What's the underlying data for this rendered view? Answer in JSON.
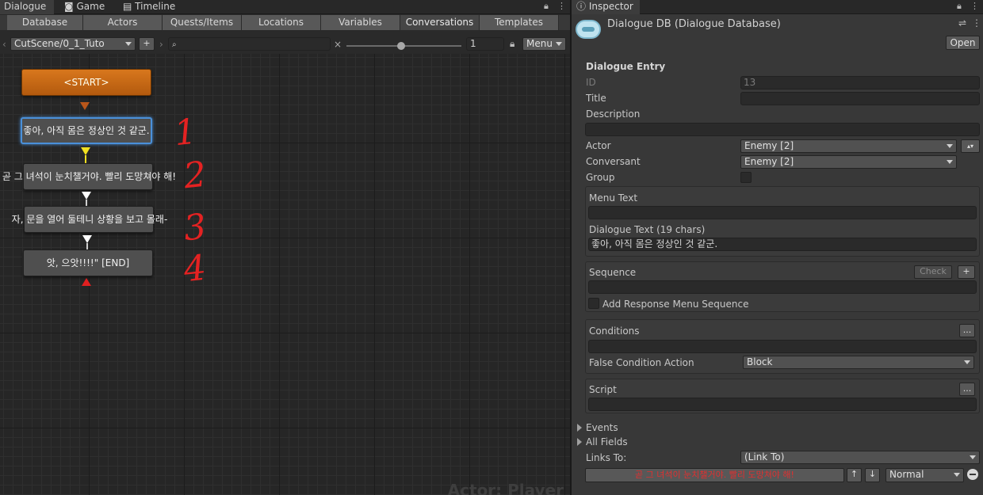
{
  "window_tabs": {
    "dialogue": "Dialogue",
    "game": "Game",
    "timeline": "Timeline",
    "inspector": "Inspector"
  },
  "sub_tabs": [
    "Database",
    "Actors",
    "Quests/Items",
    "Locations",
    "Variables",
    "Conversations",
    "Templates"
  ],
  "selected_sub_tab": "Conversations",
  "toolbar": {
    "conversation": "CutScene/0_1_Tuto",
    "add_label": "+",
    "search_placeholder": "",
    "clear": "×",
    "zoom_value": "1",
    "menu_label": "Menu"
  },
  "canvas": {
    "nodes": [
      "<START>",
      "좋아, 아직 몸은 정상인 것 같군.",
      "곧 그 녀석이 눈치챌거야. 빨리 도망쳐야 해!",
      "자, 문을 열어 둘테니 상황을 보고 몰래-",
      "앗, 으앗!!!!\" [END]"
    ],
    "annotations": [
      "1",
      "2",
      "3",
      "4"
    ],
    "watermark": "Actor: Player"
  },
  "inspector": {
    "asset_title": "Dialogue DB (Dialogue Database)",
    "open_button": "Open",
    "section_title": "Dialogue Entry",
    "id_label": "ID",
    "id_value": "13",
    "title_label": "Title",
    "title_value": "",
    "description_label": "Description",
    "description_value": "",
    "actor_label": "Actor",
    "actor_value": "Enemy [2]",
    "conversant_label": "Conversant",
    "conversant_value": "Enemy [2]",
    "group_label": "Group",
    "menu_text_label": "Menu Text",
    "menu_text_value": "",
    "dialogue_text_label": "Dialogue Text (19 chars)",
    "dialogue_text_value": "좋아, 아직 몸은 정상인 것 같군.",
    "sequence_label": "Sequence",
    "check_button": "Check",
    "plus_button": "+",
    "sequence_value": "",
    "add_response_label": "Add Response Menu Sequence",
    "conditions_label": "Conditions",
    "ellipsis": "...",
    "conditions_value": "",
    "false_condition_label": "False Condition Action",
    "false_condition_value": "Block",
    "script_label": "Script",
    "script_value": "",
    "events_label": "Events",
    "all_fields_label": "All Fields",
    "links_to_label": "Links To:",
    "links_to_value": "(Link To)",
    "link_entry_text": "곧 그 녀석이 눈치챌거야. 빨리 도망쳐야 해!",
    "link_up": "↑",
    "link_down": "↓",
    "priority_value": "Normal"
  },
  "colors": {
    "start_node": "#c8661a",
    "selection": "#4a90d9",
    "annotation": "#e42222",
    "link_text": "#e03030"
  }
}
